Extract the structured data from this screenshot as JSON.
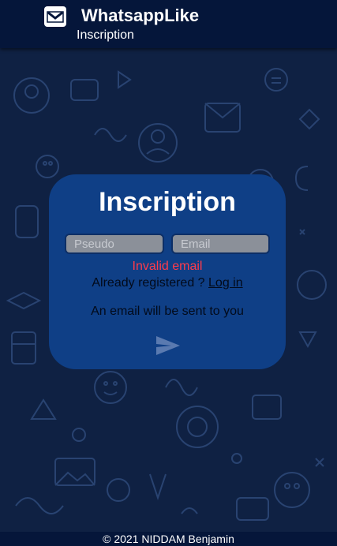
{
  "header": {
    "app_name": "WhatsappLike",
    "subtitle": "Inscription",
    "icon": "envelope-icon"
  },
  "form": {
    "title": "Inscription",
    "pseudo_placeholder": "Pseudo",
    "pseudo_value": "",
    "email_placeholder": "Email",
    "email_value": "",
    "error": "Invalid email",
    "already_text": "Already registered ?",
    "login_link": "Log in",
    "notice": "An email will be sent to you",
    "send_icon": "send-icon"
  },
  "footer": {
    "text": "© 2021 NIDDAM Benjamin"
  },
  "colors": {
    "header_bg": "#05163a",
    "page_bg": "#0f2143",
    "card_bg": "#0f3f86",
    "error": "#ff3b4a",
    "input_bg": "#8b9099"
  }
}
